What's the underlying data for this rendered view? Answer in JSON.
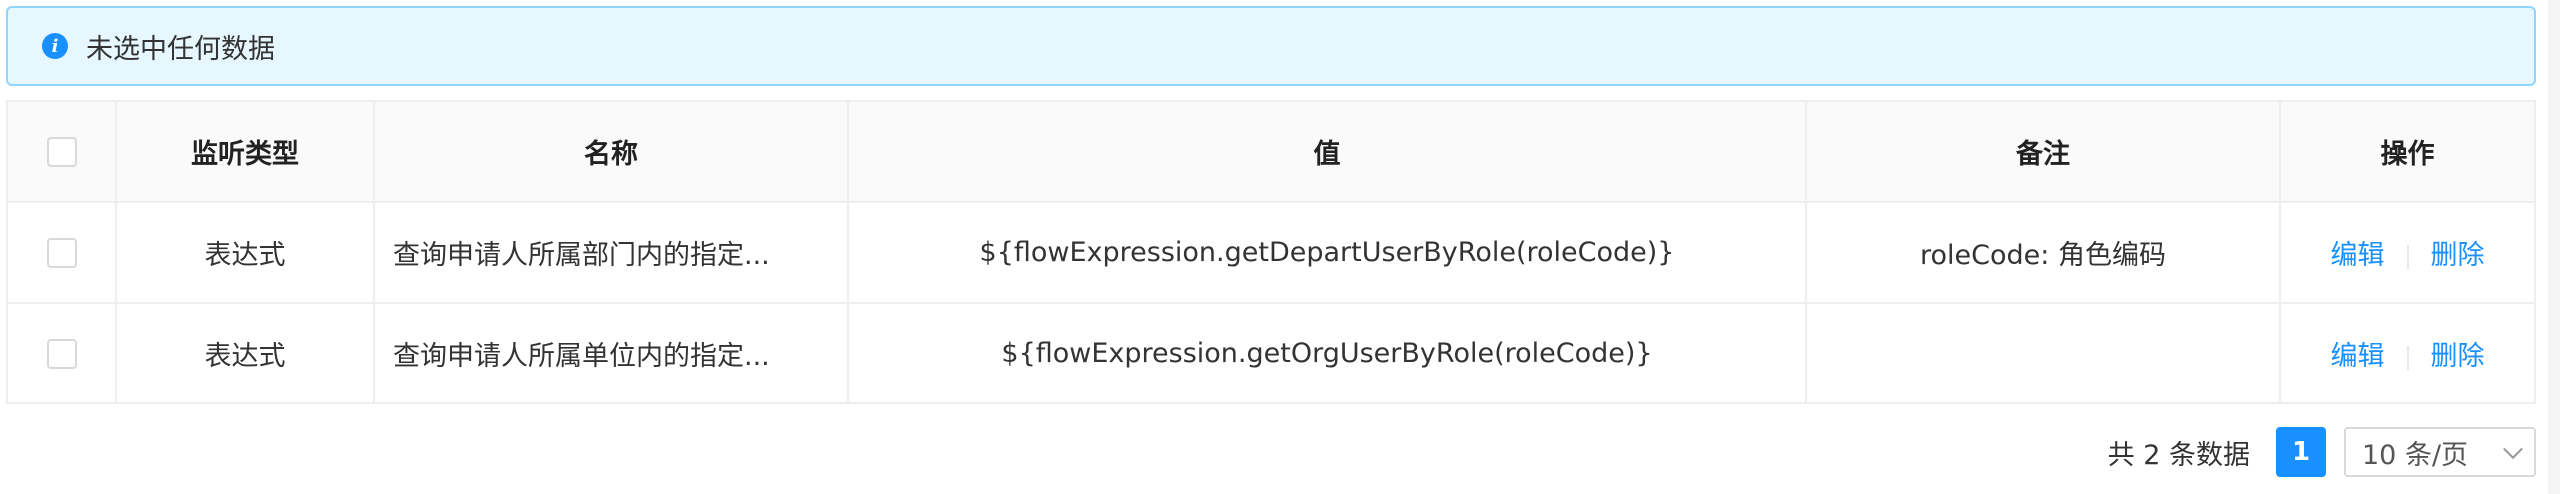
{
  "alert": {
    "icon": "info-circle-icon",
    "text": "未选中任何数据",
    "accent_color": "#1890ff"
  },
  "table": {
    "columns": [
      "监听类型",
      "名称",
      "值",
      "备注",
      "操作"
    ],
    "rows": [
      {
        "type": "表达式",
        "name": "查询申请人所属部门内的指定...",
        "value": "${flowExpression.getDepartUserByRole(roleCode)}",
        "remark": "roleCode: 角色编码",
        "edit": "编辑",
        "delete": "删除"
      },
      {
        "type": "表达式",
        "name": "查询申请人所属单位内的指定...",
        "value": "${flowExpression.getOrgUserByRole(roleCode)}",
        "remark": "",
        "edit": "编辑",
        "delete": "删除"
      }
    ]
  },
  "pagination": {
    "total_text": "共 2 条数据",
    "current_page": "1",
    "page_size": "10 条/页"
  }
}
